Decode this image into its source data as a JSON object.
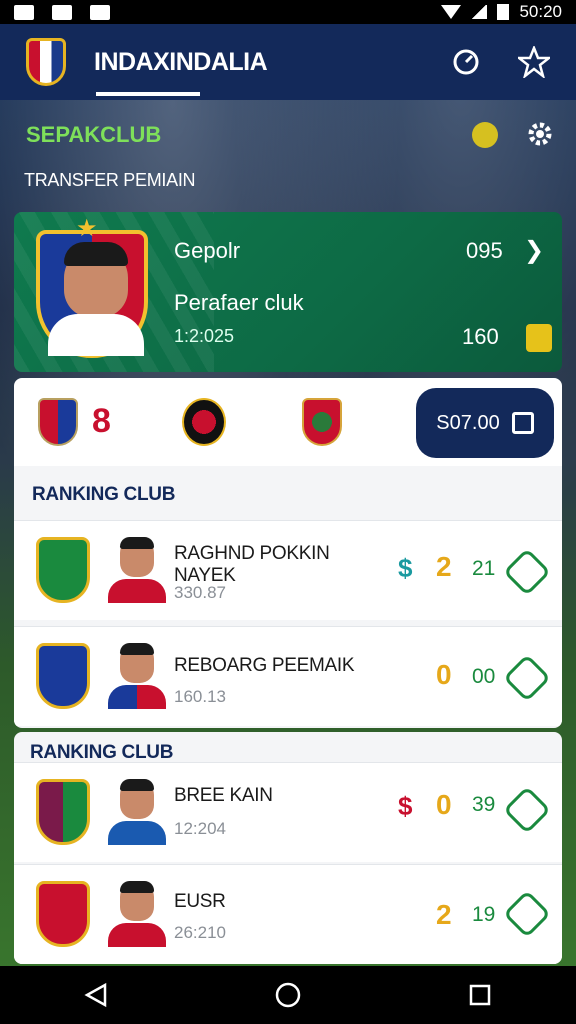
{
  "status_bar": {
    "time": "50:20"
  },
  "header": {
    "title": "INDAXINDALIA"
  },
  "section": {
    "title": "SEPAKCLUB",
    "subtitle": "TRANSFER PEMIAIN"
  },
  "transfer": {
    "label1": "Gepolr",
    "label2": "Perafaer cluk",
    "date": "1:2:025",
    "value1": "095",
    "value2": "160"
  },
  "club_strip": {
    "number": "8",
    "price": "S07.00"
  },
  "ranking1": {
    "title": "RANKING CLUB",
    "rows": [
      {
        "name": "RAGHND POKKIN NAYEK",
        "sub": "330.87",
        "coin": "2",
        "num": "21"
      },
      {
        "name": "REBOARG PEEMAIK",
        "sub": "160.13",
        "coin": "0",
        "num": "00"
      }
    ]
  },
  "ranking2": {
    "title": "RANKING CLUB",
    "rows": [
      {
        "name": "BREE KAIN",
        "sub": "12:204",
        "coin": "0",
        "num": "39"
      },
      {
        "name": "EUSR",
        "sub": "26:210",
        "coin": "2",
        "num": "19"
      }
    ]
  },
  "colors": {
    "primary": "#13295a",
    "green": "#1a8a3e",
    "accent": "#e6a81a",
    "red": "#c8102e"
  },
  "icons": {
    "timer": "timer-icon",
    "star": "star-icon",
    "settings": "gear-icon",
    "back": "back-icon",
    "home": "home-icon",
    "recents": "recents-icon"
  }
}
